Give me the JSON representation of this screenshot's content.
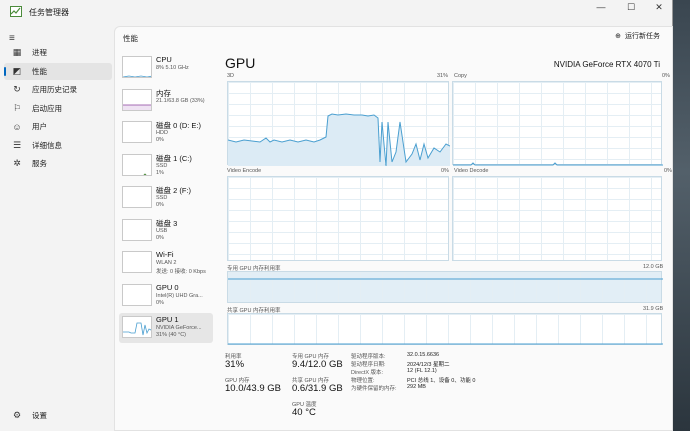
{
  "window": {
    "title": "任务管理器",
    "min": "—",
    "max": "☐",
    "close": "✕"
  },
  "nav": {
    "items": [
      {
        "label": "进程",
        "icon": "▦"
      },
      {
        "label": "性能",
        "icon": "◩"
      },
      {
        "label": "应用历史记录",
        "icon": "↻"
      },
      {
        "label": "启动应用",
        "icon": "⚐"
      },
      {
        "label": "用户",
        "icon": "☺"
      },
      {
        "label": "详细信息",
        "icon": "☰"
      },
      {
        "label": "服务",
        "icon": "✲"
      }
    ],
    "settings": {
      "label": "设置",
      "icon": "⚙"
    },
    "menu_icon": "≡"
  },
  "header": {
    "title": "性能",
    "new_task": "运行新任务",
    "new_task_icon": "⊕"
  },
  "devices": [
    {
      "title": "CPU",
      "line1": "8% 5.10 GHz",
      "line2": ""
    },
    {
      "title": "内存",
      "line1": "21.1/63.8 GB (33%)",
      "line2": ""
    },
    {
      "title": "磁盘 0 (D: E:)",
      "line1": "HDD",
      "line2": "0%"
    },
    {
      "title": "磁盘 1 (C:)",
      "line1": "SSD",
      "line2": "1%"
    },
    {
      "title": "磁盘 2 (F:)",
      "line1": "SSD",
      "line2": "0%"
    },
    {
      "title": "磁盘 3",
      "line1": "USB",
      "line2": "0%"
    },
    {
      "title": "Wi-Fi",
      "line1": "WLAN 2",
      "line2": "发送: 0 接收: 0 Kbps"
    },
    {
      "title": "GPU 0",
      "line1": "Intel(R) UHD Gra...",
      "line2": "0%"
    },
    {
      "title": "GPU 1",
      "line1": "NVIDIA GeForce...",
      "line2": "31% (40 °C)"
    }
  ],
  "gpu": {
    "title": "GPU",
    "name": "NVIDIA GeForce RTX 4070 Ti",
    "engines": [
      {
        "name": "3D",
        "value": "31%"
      },
      {
        "name": "Copy",
        "value": "0%"
      },
      {
        "name": "Video Encode",
        "value": "0%"
      },
      {
        "name": "Video Decode",
        "value": "0%"
      }
    ],
    "dedicated_label": "专用 GPU 内存利用率",
    "dedicated_max": "12.0 GB",
    "shared_label": "共享 GPU 内存利用率",
    "shared_max": "31.9 GB",
    "stats": {
      "util_label": "利用率",
      "util_value": "31%",
      "dedicated_mem_label": "专用 GPU 内存",
      "dedicated_mem_value": "9.4/12.0 GB",
      "gpu_mem_label": "GPU 内存",
      "gpu_mem_value": "10.0/43.9 GB",
      "shared_mem_label": "共享 GPU 内存",
      "shared_mem_value": "0.6/31.9 GB",
      "temp_label": "GPU 温度",
      "temp_value": "40 °C"
    },
    "details": [
      {
        "k": "驱动程序版本:",
        "v": "32.0.15.6636"
      },
      {
        "k": "驱动程序日期:",
        "v": "2024/12/3 星期二"
      },
      {
        "k": "DirectX 版本:",
        "v": "12 (FL 12.1)"
      },
      {
        "k": "物理位置:",
        "v": "PCI 总线 1、设备 0、功能 0"
      },
      {
        "k": "为硬件保留的内存:",
        "v": "292 MB"
      }
    ]
  },
  "colors": {
    "accent": "#0067c0",
    "gpu_line": "#4a9fd0",
    "mem_line": "#8a3f9e"
  }
}
